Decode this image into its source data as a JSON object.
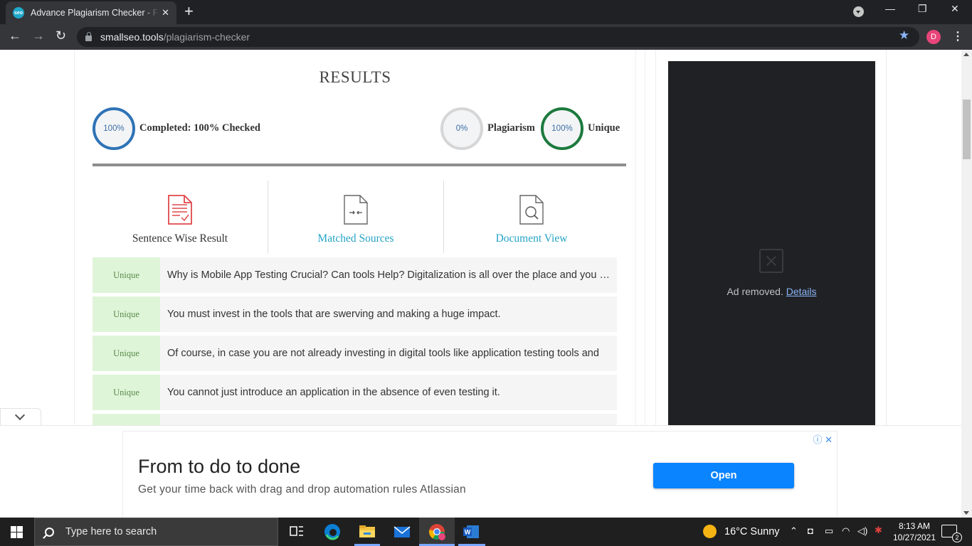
{
  "browser": {
    "tab_title": "Advance Plagiarism Checker - Free",
    "favicon_text": "seo",
    "url_host": "smallseo.tools",
    "url_path": "/plagiarism-checker",
    "profile_initial": "D"
  },
  "results": {
    "title": "RESULTS",
    "completed_percent": "100%",
    "completed_label": "Completed: 100% Checked",
    "plagiarism_percent": "0%",
    "plagiarism_label": "Plagiarism",
    "unique_percent": "100%",
    "unique_label": "Unique",
    "tabs": [
      {
        "label": "Sentence Wise Result",
        "icon": "document-lines-icon"
      },
      {
        "label": "Matched Sources",
        "icon": "compare-document-icon"
      },
      {
        "label": "Document View",
        "icon": "search-document-icon"
      }
    ],
    "rows": [
      {
        "status": "Unique",
        "text": "Why is Mobile App Testing Crucial? Can tools Help? Digitalization is all over the place and you must invest in the tools"
      },
      {
        "status": "Unique",
        "text": "You must invest in the tools that are swerving and making a huge impact."
      },
      {
        "status": "Unique",
        "text": "Of course, in case you are not already investing in digital tools like application testing tools and"
      },
      {
        "status": "Unique",
        "text": "You cannot just introduce an application in the absence of even testing it."
      }
    ]
  },
  "side_ad": {
    "removed_text": "Ad removed.",
    "details_link": "Details"
  },
  "bottom_ad": {
    "headline": "From to do to done",
    "subtext": "Get your time back with drag and drop automation rules Atlassian",
    "cta": "Open",
    "info_glyph": "ⓘ",
    "close_glyph": "✕"
  },
  "taskbar": {
    "search_placeholder": "Type here to search",
    "weather": "16°C  Sunny",
    "time": "8:13 AM",
    "date": "10/27/2021",
    "notification_count": "2"
  }
}
